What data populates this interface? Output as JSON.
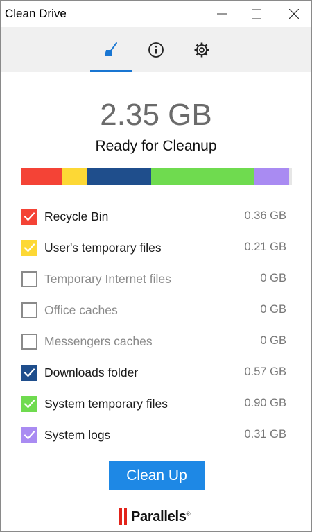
{
  "window": {
    "title": "Clean Drive"
  },
  "tabs": [
    {
      "icon": "broom-icon",
      "active": true
    },
    {
      "icon": "info-icon",
      "active": false
    },
    {
      "icon": "gear-icon",
      "active": false
    }
  ],
  "summary": {
    "total": "2.35 GB",
    "status": "Ready for Cleanup"
  },
  "usage_bar": {
    "segments": [
      {
        "category": "Recycle Bin",
        "gb": 0.36,
        "color": "#f44336"
      },
      {
        "category": "User's temporary files",
        "gb": 0.21,
        "color": "#fdd835"
      },
      {
        "category": "Downloads folder",
        "gb": 0.57,
        "color": "#1f4e8c"
      },
      {
        "category": "System temporary files",
        "gb": 0.9,
        "color": "#6fdb4f"
      },
      {
        "category": "System logs",
        "gb": 0.31,
        "color": "#a98bf2"
      }
    ]
  },
  "items": [
    {
      "label": "Recycle Bin",
      "value": "0.36 GB",
      "checked": true,
      "color": "#f44336"
    },
    {
      "label": "User's temporary files",
      "value": "0.21 GB",
      "checked": true,
      "color": "#fdd835"
    },
    {
      "label": "Temporary Internet files",
      "value": "0 GB",
      "checked": false,
      "color": "#8a8a8a"
    },
    {
      "label": "Office caches",
      "value": "0 GB",
      "checked": false,
      "color": "#8a8a8a"
    },
    {
      "label": "Messengers caches",
      "value": "0 GB",
      "checked": false,
      "color": "#8a8a8a"
    },
    {
      "label": "Downloads folder",
      "value": "0.57 GB",
      "checked": true,
      "color": "#1f4e8c"
    },
    {
      "label": "System temporary files",
      "value": "0.90 GB",
      "checked": true,
      "color": "#6fdb4f"
    },
    {
      "label": "System logs",
      "value": "0.31 GB",
      "checked": true,
      "color": "#a98bf2"
    }
  ],
  "action": {
    "label": "Clean Up"
  },
  "brand": {
    "name": "Parallels",
    "mark": "®"
  },
  "colors": {
    "accent": "#1976d2",
    "button": "#1e88e5",
    "brand_red": "#e2231a"
  }
}
